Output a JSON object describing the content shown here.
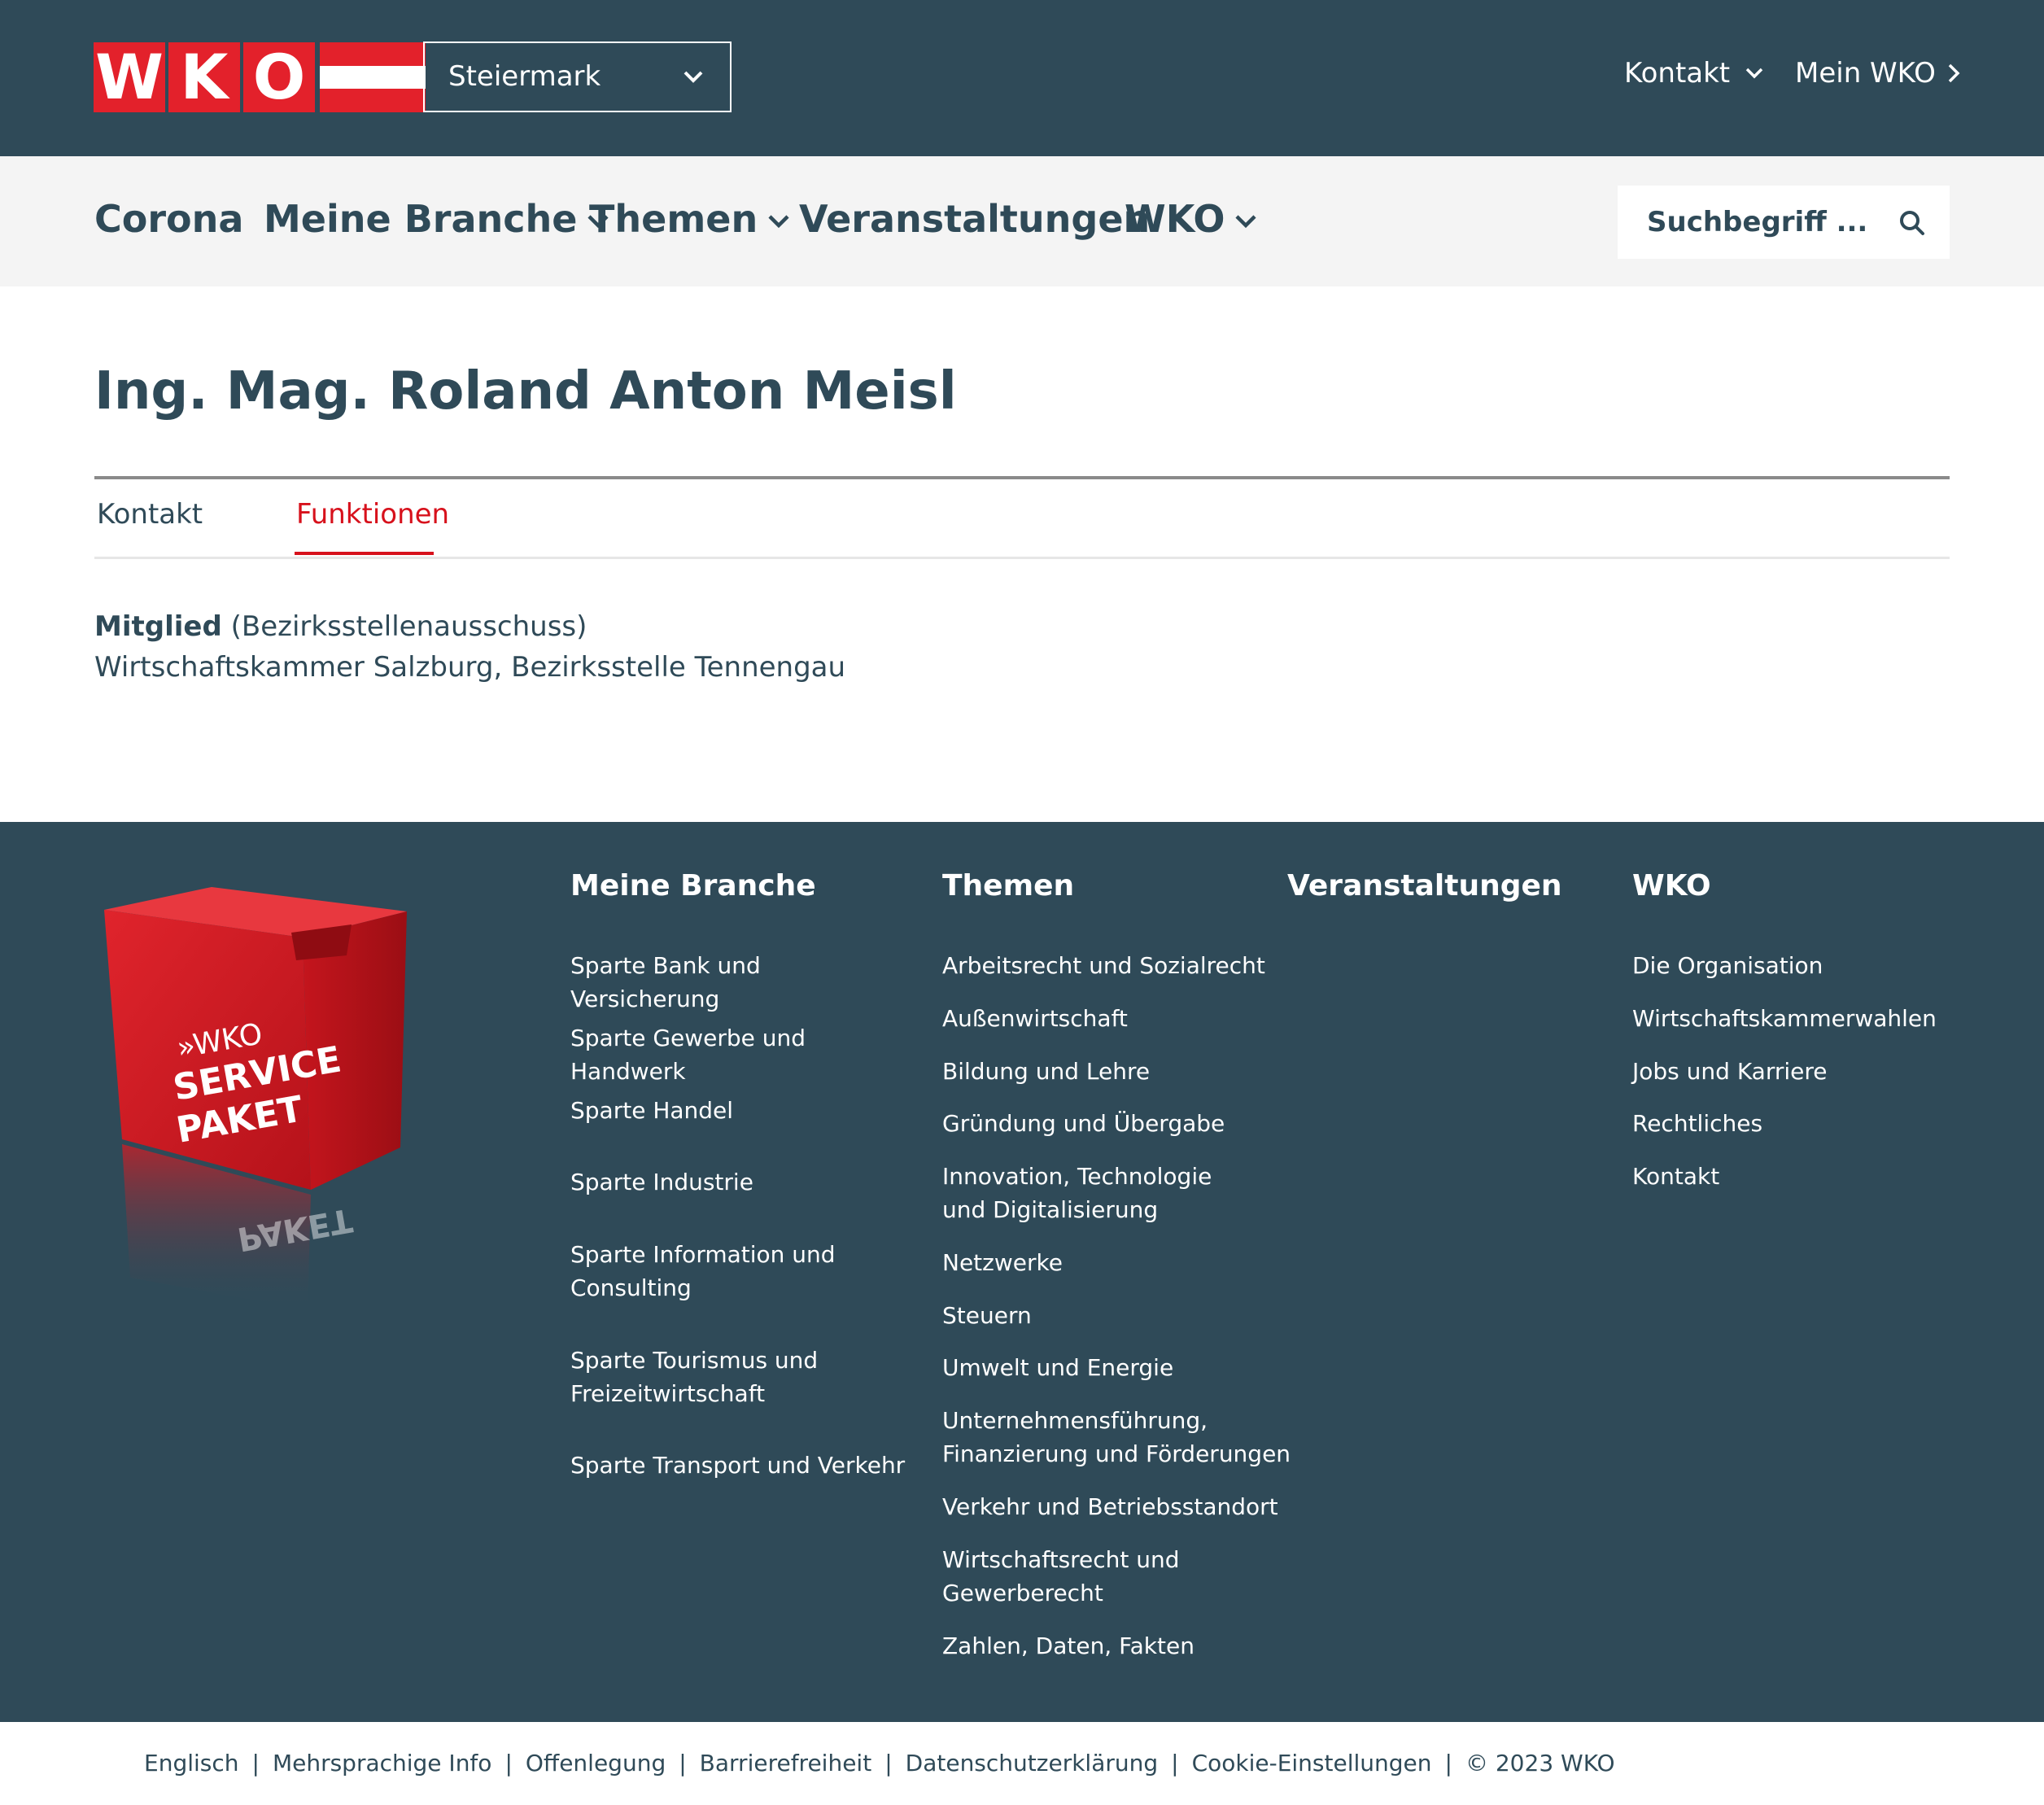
{
  "header": {
    "logo_letters": [
      "W",
      "K",
      "O"
    ],
    "region": "Steiermark",
    "contact": "Kontakt",
    "mein_wko": "Mein WKO"
  },
  "nav": {
    "items": [
      "Corona",
      "Meine Branche",
      "Themen",
      "Veranstaltungen",
      "WKO"
    ],
    "search_placeholder": "Suchbegriff ..."
  },
  "person": {
    "name": "Ing. Mag. Roland Anton Meisl",
    "tabs": [
      "Kontakt",
      "Funktionen"
    ],
    "active_tab": "Funktionen",
    "function_role": "Mitglied",
    "function_body": "(Bezirksstellenausschuss)",
    "function_org": "Wirtschaftskammer Salzburg, Bezirksstelle Tennengau"
  },
  "footer": {
    "service_box": {
      "line1": "»WKO",
      "line2": "SERVICE",
      "line3": "PAKET",
      "mirror": "PAKET"
    },
    "meine_branche": {
      "title": "Meine Branche",
      "links": [
        "Sparte Bank und Versicherung",
        "Sparte Gewerbe und Handwerk",
        "Sparte Handel",
        "Sparte Industrie",
        "Sparte Information und Consulting",
        "Sparte Tourismus und Freizeitwirtschaft",
        "Sparte Transport und Verkehr"
      ]
    },
    "themen": {
      "title": "Themen",
      "links": [
        "Arbeitsrecht und Sozialrecht",
        "Außenwirtschaft",
        "Bildung und Lehre",
        "Gründung und Übergabe",
        "Innovation, Technologie und Digitalisierung",
        "Netzwerke",
        "Steuern",
        "Umwelt und Energie",
        "Unternehmensführung, Finanzierung und Förderungen",
        "Verkehr und Betriebsstandort",
        "Wirtschaftsrecht und Gewerberecht",
        "Zahlen, Daten, Fakten"
      ]
    },
    "veranstaltungen": {
      "title": "Veranstaltungen"
    },
    "wko": {
      "title": "WKO",
      "links": [
        "Die Organisation",
        "Wirtschaftskammerwahlen",
        "Jobs und Karriere",
        "Rechtliches",
        "Kontakt"
      ]
    }
  },
  "bottom_links": [
    "Englisch",
    "Mehrsprachige Info",
    "Offenlegung",
    "Barrierefreiheit",
    "Datenschutzerklärung",
    "Cookie-Einstellungen",
    "© 2023 WKO"
  ],
  "colors": {
    "primary": "#2f4a58",
    "accent": "#e3212b",
    "tab_active": "#d7111c"
  }
}
